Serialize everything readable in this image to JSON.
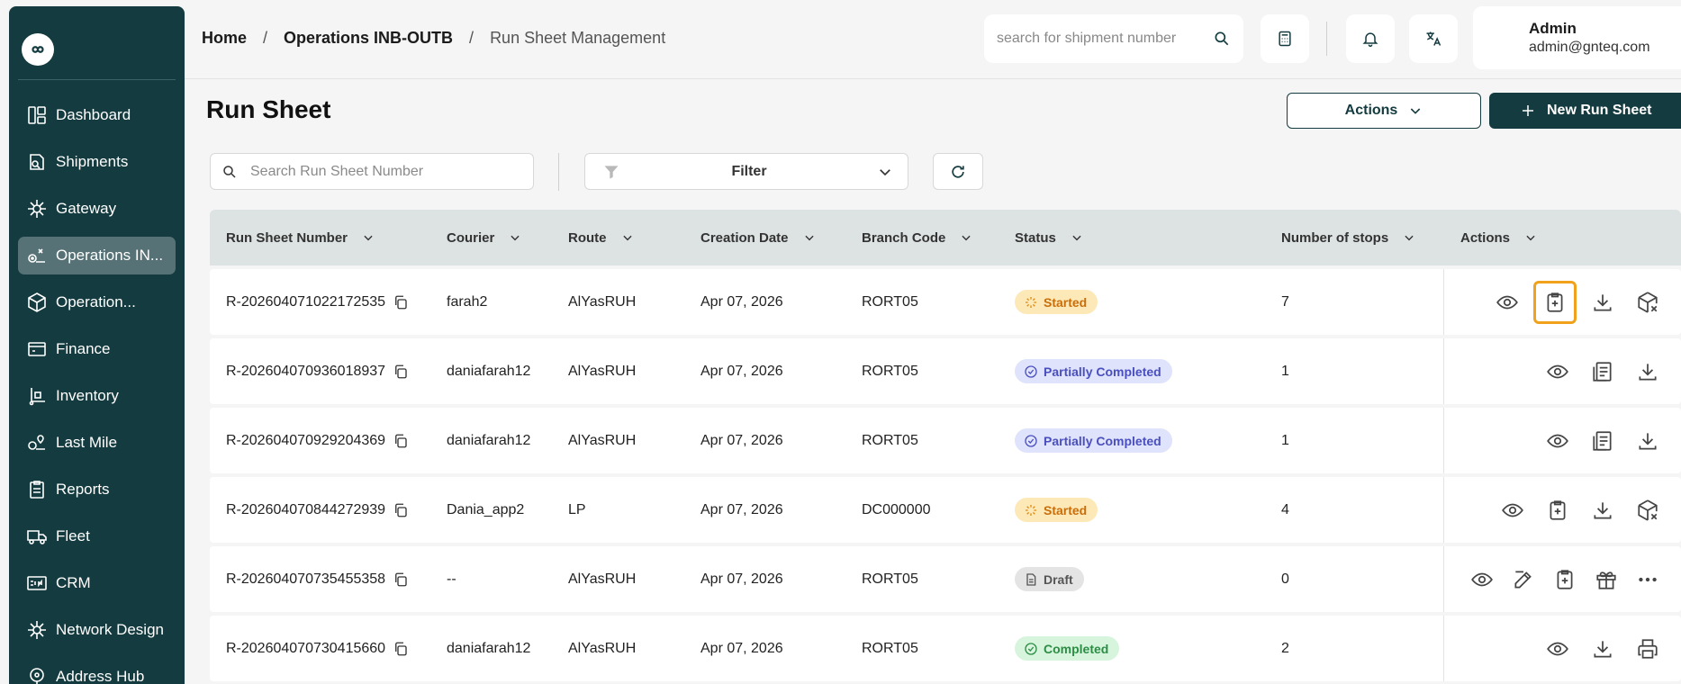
{
  "sidebar": {
    "items": [
      {
        "label": "Dashboard",
        "icon": "dashboard-icon"
      },
      {
        "label": "Shipments",
        "icon": "shipments-icon"
      },
      {
        "label": "Gateway",
        "icon": "gateway-icon"
      },
      {
        "label": "Operations IN...",
        "icon": "operations-icon",
        "active": true
      },
      {
        "label": "Operation...",
        "icon": "operation-box-icon"
      },
      {
        "label": "Finance",
        "icon": "finance-icon"
      },
      {
        "label": "Inventory",
        "icon": "inventory-icon"
      },
      {
        "label": "Last Mile",
        "icon": "last-mile-icon"
      },
      {
        "label": "Reports",
        "icon": "reports-icon"
      },
      {
        "label": "Fleet",
        "icon": "fleet-icon"
      },
      {
        "label": "CRM",
        "icon": "crm-icon"
      },
      {
        "label": "Network Design",
        "icon": "network-icon"
      },
      {
        "label": "Address Hub",
        "icon": "address-icon"
      }
    ]
  },
  "breadcrumb": {
    "home": "Home",
    "section": "Operations INB-OUTB",
    "current": "Run Sheet Management",
    "sep": "/"
  },
  "header": {
    "search_placeholder": "search for shipment number",
    "user_name": "Admin",
    "user_email": "admin@gnteq.com"
  },
  "page": {
    "title": "Run Sheet",
    "actions_label": "Actions",
    "new_label": "New Run Sheet",
    "search_placeholder": "Search Run Sheet Number",
    "filter_label": "Filter"
  },
  "table": {
    "columns": [
      "Run Sheet Number",
      "Courier",
      "Route",
      "Creation Date",
      "Branch Code",
      "Status",
      "Number of stops",
      "Actions"
    ],
    "rows": [
      {
        "number": "R-202604071022172535",
        "courier": "farah2",
        "route": "AlYasRUH",
        "date": "Apr 07, 2026",
        "branch": "RORT05",
        "status": "Started",
        "stops": "7"
      },
      {
        "number": "R-202604070936018937",
        "courier": "daniafarah12",
        "route": "AlYasRUH",
        "date": "Apr 07, 2026",
        "branch": "RORT05",
        "status": "Partially Completed",
        "stops": "1"
      },
      {
        "number": "R-202604070929204369",
        "courier": "daniafarah12",
        "route": "AlYasRUH",
        "date": "Apr 07, 2026",
        "branch": "RORT05",
        "status": "Partially Completed",
        "stops": "1"
      },
      {
        "number": "R-202604070844272939",
        "courier": "Dania_app2",
        "route": "LP",
        "date": "Apr 07, 2026",
        "branch": "DC000000",
        "status": "Started",
        "stops": "4"
      },
      {
        "number": "R-202604070735455358",
        "courier": "--",
        "route": "AlYasRUH",
        "date": "Apr 07, 2026",
        "branch": "RORT05",
        "status": "Draft",
        "stops": "0"
      },
      {
        "number": "R-202604070730415660",
        "courier": "daniafarah12",
        "route": "AlYasRUH",
        "date": "Apr 07, 2026",
        "branch": "RORT05",
        "status": "Completed",
        "stops": "2"
      }
    ]
  },
  "colors": {
    "sidebar": "#143b3f",
    "accent": "#143b3f",
    "highlight": "#f0a21c",
    "started": "#c86e0a",
    "partial": "#4a4fbf",
    "completed": "#2c8d45"
  }
}
